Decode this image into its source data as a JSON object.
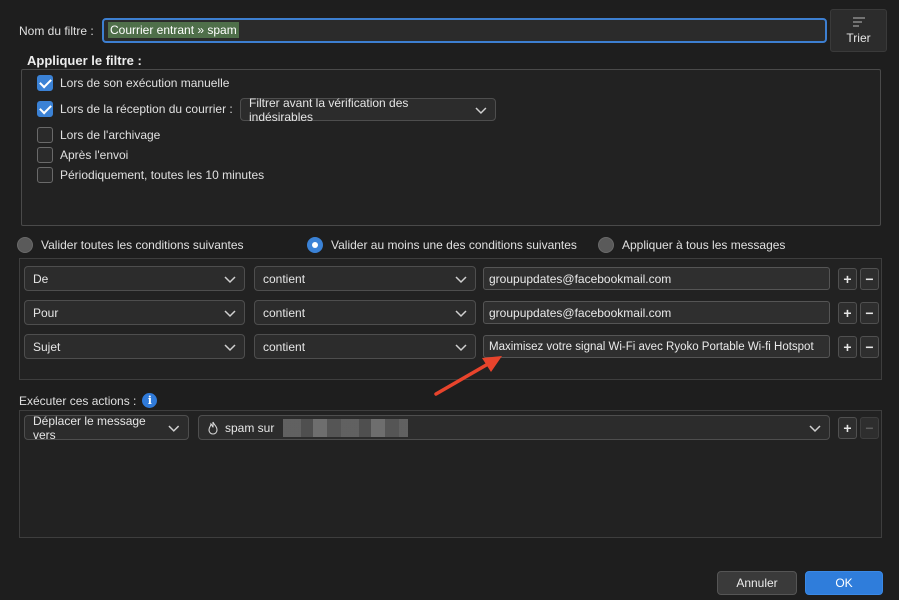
{
  "filter_name": {
    "label": "Nom du filtre :",
    "value": "Courrier entrant » spam"
  },
  "sort_button": {
    "label": "Trier",
    "icon": "sort-lines-icon"
  },
  "apply_filter": {
    "title": "Appliquer le filtre :",
    "options": [
      {
        "label": "Lors de son exécution manuelle",
        "checked": true
      },
      {
        "label": "Lors de la réception du courrier :",
        "checked": true
      },
      {
        "label": "Lors de l'archivage",
        "checked": false
      },
      {
        "label": "Après l'envoi",
        "checked": false
      },
      {
        "label": "Périodiquement, toutes les 10 minutes",
        "checked": false
      }
    ],
    "reception_mode": "Filtrer avant la vérification des indésirables"
  },
  "match_mode": {
    "options": [
      {
        "label": "Valider toutes les conditions suivantes",
        "selected": false
      },
      {
        "label": "Valider au moins une des conditions suivantes",
        "selected": true
      },
      {
        "label": "Appliquer à tous les messages",
        "selected": false
      }
    ]
  },
  "conditions": [
    {
      "field": "De",
      "operator": "contient",
      "value": "groupupdates@facebookmail.com"
    },
    {
      "field": "Pour",
      "operator": "contient",
      "value": "groupupdates@facebookmail.com"
    },
    {
      "field": "Sujet",
      "operator": "contient",
      "value": "Maximisez votre signal Wi-Fi avec Ryoko Portable Wi-fi Hotspot"
    }
  ],
  "row_buttons": {
    "add": "+",
    "remove": "−"
  },
  "actions": {
    "label": "Exécuter ces actions :",
    "info_icon": "i",
    "items": [
      {
        "action": "Déplacer le message vers",
        "target": "spam sur"
      }
    ]
  },
  "footer": {
    "cancel": "Annuler",
    "ok": "OK"
  },
  "colors": {
    "accent": "#3b82d6",
    "annotation": "#e8442c",
    "selection": "#4f6f4a"
  }
}
